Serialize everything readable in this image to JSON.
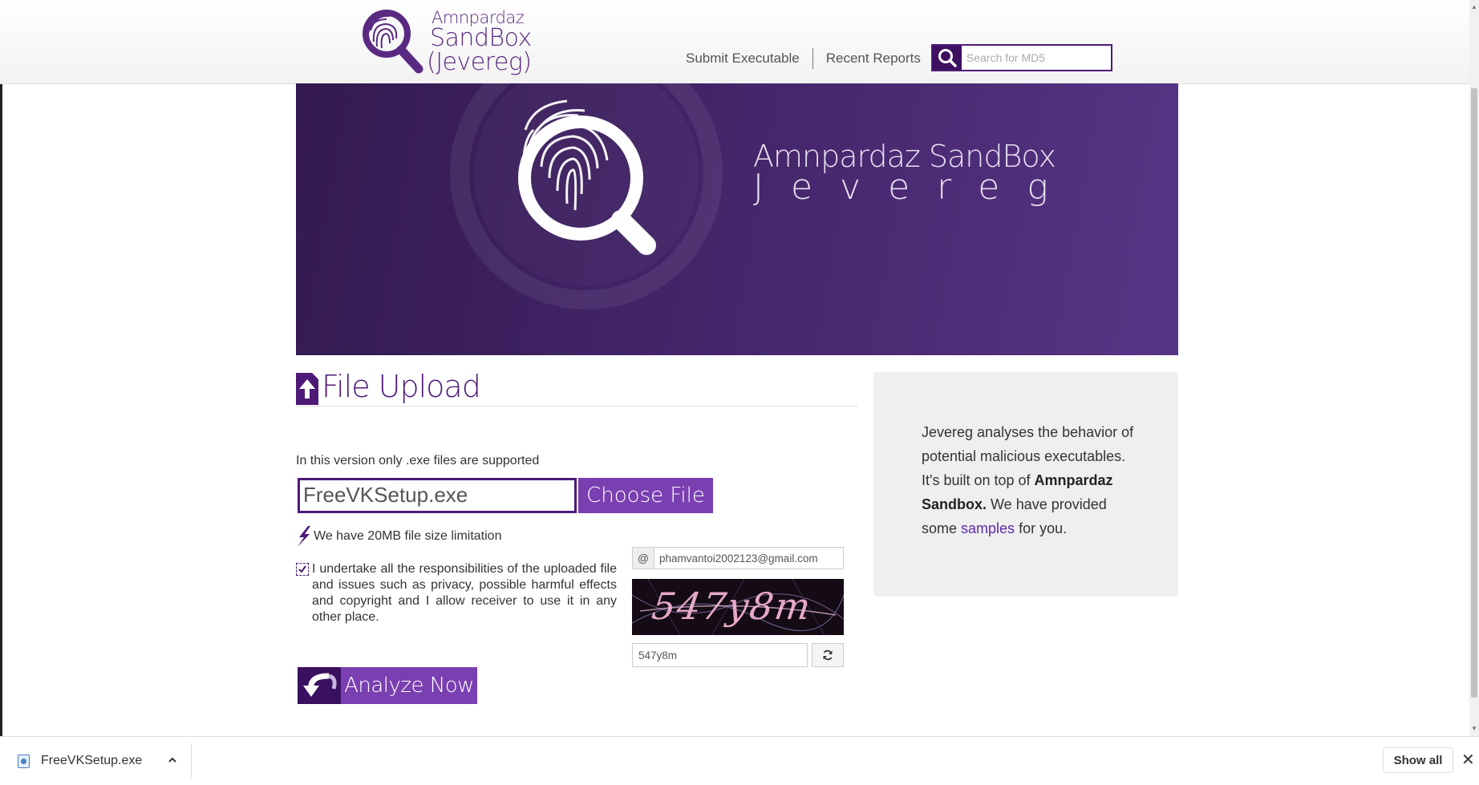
{
  "header": {
    "logo": {
      "line1": "Amnpardaz",
      "line2": "SandBox",
      "line3": "(Jevereg)"
    },
    "nav": [
      {
        "label": "Submit Executable"
      },
      {
        "label": "Recent Reports"
      }
    ],
    "search": {
      "placeholder": "Search for MD5",
      "icon": "search-icon"
    }
  },
  "banner": {
    "title_line1": "Amnpardaz SandBox",
    "title_line2": "Jevereg"
  },
  "upload": {
    "heading": "File Upload",
    "supported_note": "In this version only .exe files are supported",
    "file_name": "FreeVKSetup.exe",
    "choose_label": "Choose File",
    "size_limit": "We have 20MB file size limitation",
    "terms_checked": true,
    "terms_text": "I undertake all the responsibilities of the uploaded file and issues such as privacy, possible harmful effects and copyright and I allow receiver to use it in any other place.",
    "email_addon": "@",
    "email_value": "phamvantoi2002123@gmail.com",
    "captcha_image_text": "547y8m",
    "captcha_value": "547y8m",
    "analyze_label": "Analyze Now"
  },
  "info": {
    "text_before": "Jevereg analyses the behavior of potential malicious executables. It's built on top of ",
    "bold_text": "Amnpardaz Sandbox.",
    "text_mid": " We have provided some ",
    "link_text": "samples",
    "text_after": " for you."
  },
  "download_bar": {
    "file_name": "FreeVKSetup.exe",
    "show_all_label": "Show all",
    "close_glyph": "✕"
  },
  "colors": {
    "brand_purple": "#4e1a78",
    "button_purple": "#7a3fb0",
    "link": "#5b2ba8"
  }
}
